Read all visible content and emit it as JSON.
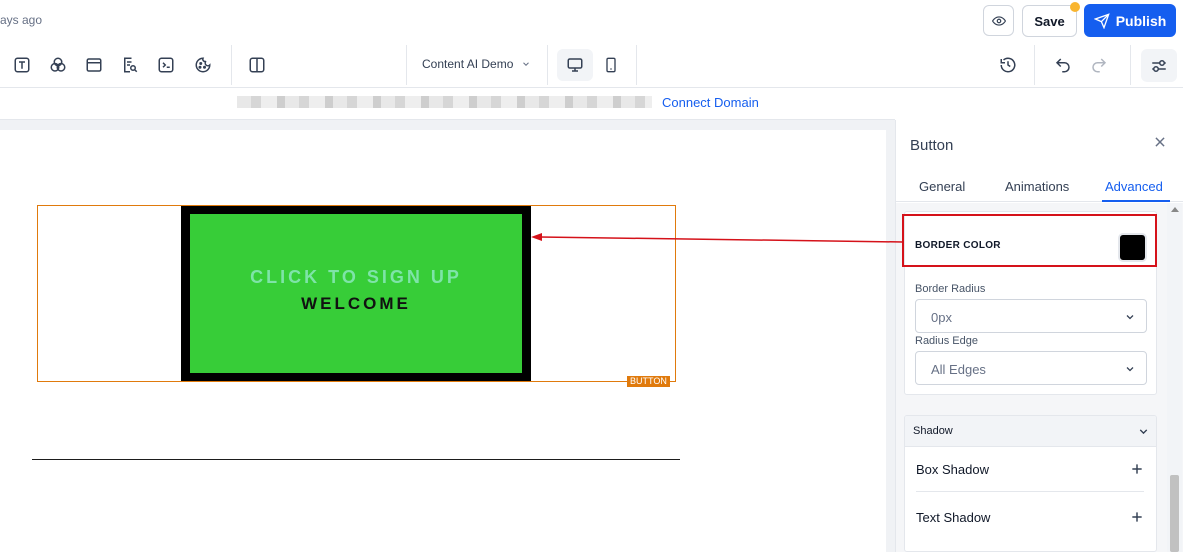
{
  "header": {
    "saved_status": "ays ago",
    "save_label": "Save",
    "publish_label": "Publish"
  },
  "toolbar": {
    "page_selector": "Content AI Demo"
  },
  "domain_bar": {
    "connect_domain": "Connect Domain"
  },
  "canvas": {
    "button_text": "CLICK TO SIGN UP",
    "button_subtext": "WELCOME",
    "element_tag": "BUTTON"
  },
  "panel": {
    "title": "Button",
    "tabs": [
      {
        "label": "General"
      },
      {
        "label": "Animations"
      },
      {
        "label": "Advanced"
      }
    ],
    "border_color_label": "BORDER COLOR",
    "border_color_value": "#000000",
    "border_radius_label": "Border Radius",
    "border_radius_value": "0px",
    "radius_edge_label": "Radius Edge",
    "radius_edge_value": "All Edges",
    "shadow_section": "Shadow",
    "box_shadow_label": "Box Shadow",
    "text_shadow_label": "Text Shadow"
  },
  "colors": {
    "accent": "#155eef",
    "button_bg": "#37cd38",
    "button_border": "#000000",
    "selection": "#e07a0c",
    "highlight": "#d5121a"
  },
  "icons": [
    "preview-icon",
    "publish-send-icon",
    "text-element-icon",
    "shapes-icon",
    "section-icon",
    "search-page-icon",
    "code-icon",
    "cookie-icon",
    "columns-icon",
    "desktop-icon",
    "mobile-icon",
    "history-icon",
    "undo-icon",
    "redo-icon",
    "settings-sliders-icon",
    "close-icon",
    "chevron-down-icon",
    "plus-icon"
  ]
}
